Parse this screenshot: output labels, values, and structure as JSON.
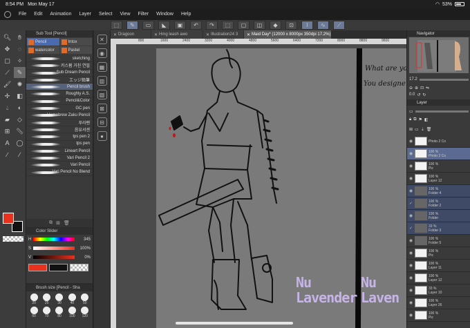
{
  "status": {
    "time": "8:54 PM",
    "date": "Mon May 17",
    "battery": "53%"
  },
  "menu": [
    "File",
    "Edit",
    "Animation",
    "Layer",
    "Select",
    "View",
    "Filter",
    "Window",
    "Help"
  ],
  "subtool": {
    "title": "Sub Tool [Pencil]",
    "tabs": [
      "Pencil",
      "Intox",
      "watercolor",
      "Pastel"
    ],
    "brushes": [
      "sketching",
      "카스펌 거친 연필",
      "Sub Dream Pencil",
      "エッジ鉛筆",
      "Pencil brush",
      "Roughly A.S.",
      "Pencil&Color",
      "GC pen",
      "Homebrew Zaku Pencil",
      "푸라펜",
      "음유서센",
      "tps pen 2",
      "tps pen",
      "Lineart Pencil",
      "Vari Pencil 2",
      "Vari Pencil",
      "Vari Pencil No Blend"
    ],
    "active_brush": "Pencil brush"
  },
  "color_slider": {
    "title": "Color Slider",
    "h_label": "H",
    "h": "345",
    "s_label": "S",
    "s": "100%",
    "v_label": "V",
    "v": "0%"
  },
  "brush_size": {
    "title": "Brush size [Pencil - Sha",
    "sizes": [
      "20",
      "25",
      "30",
      "40",
      "50",
      "60",
      "70",
      "80",
      "100",
      "120"
    ]
  },
  "doc_tabs": [
    "Dragoon",
    "Hmg leash awo",
    "Illustration24 3",
    "Maid Day* (12000 x 8000px 350dpi 17.2%)"
  ],
  "ruler": [
    "800",
    "1600",
    "2400",
    "3200",
    "4000",
    "4800",
    "5600",
    "6400",
    "7200",
    "8000",
    "8800",
    "9600"
  ],
  "canvas": {
    "text1": "What are yo",
    "text2": "You designe",
    "lav1a": "Nu",
    "lav1b": "Lavender",
    "lav2a": "Nu",
    "lav2b": "Laven"
  },
  "navigator": {
    "title": "Navigator",
    "zoom": "17.2",
    "angle": "0.0"
  },
  "layer_panel": {
    "title": "Layer",
    "layers": [
      {
        "pct": "",
        "name": "Photo 2 Co",
        "type": "layer"
      },
      {
        "pct": "100 %",
        "name": "Photo 2 Co",
        "type": "layer"
      },
      {
        "pct": "100 %",
        "name": "Pic",
        "type": "layer"
      },
      {
        "pct": "100 %",
        "name": "Layer 12",
        "type": "layer"
      },
      {
        "pct": "100 %",
        "name": "Folder 4",
        "type": "folder"
      },
      {
        "pct": "100 %",
        "name": "Folder 2",
        "type": "folder"
      },
      {
        "pct": "100 %",
        "name": "Folder",
        "type": "folder"
      },
      {
        "pct": "33 %",
        "name": "Folder 3",
        "type": "folder"
      },
      {
        "pct": "100 %",
        "name": "Folder 5",
        "type": "layer"
      },
      {
        "pct": "100 %",
        "name": "Pic",
        "type": "layer"
      },
      {
        "pct": "100 %",
        "name": "Layer 11",
        "type": "layer"
      },
      {
        "pct": "100 %",
        "name": "Layer 12",
        "type": "layer"
      },
      {
        "pct": "33 %",
        "name": "Layer 10",
        "type": "layer"
      },
      {
        "pct": "100 %",
        "name": "Layer 26",
        "type": "layer"
      },
      {
        "pct": "100 %",
        "name": "Pic",
        "type": "layer"
      }
    ]
  }
}
